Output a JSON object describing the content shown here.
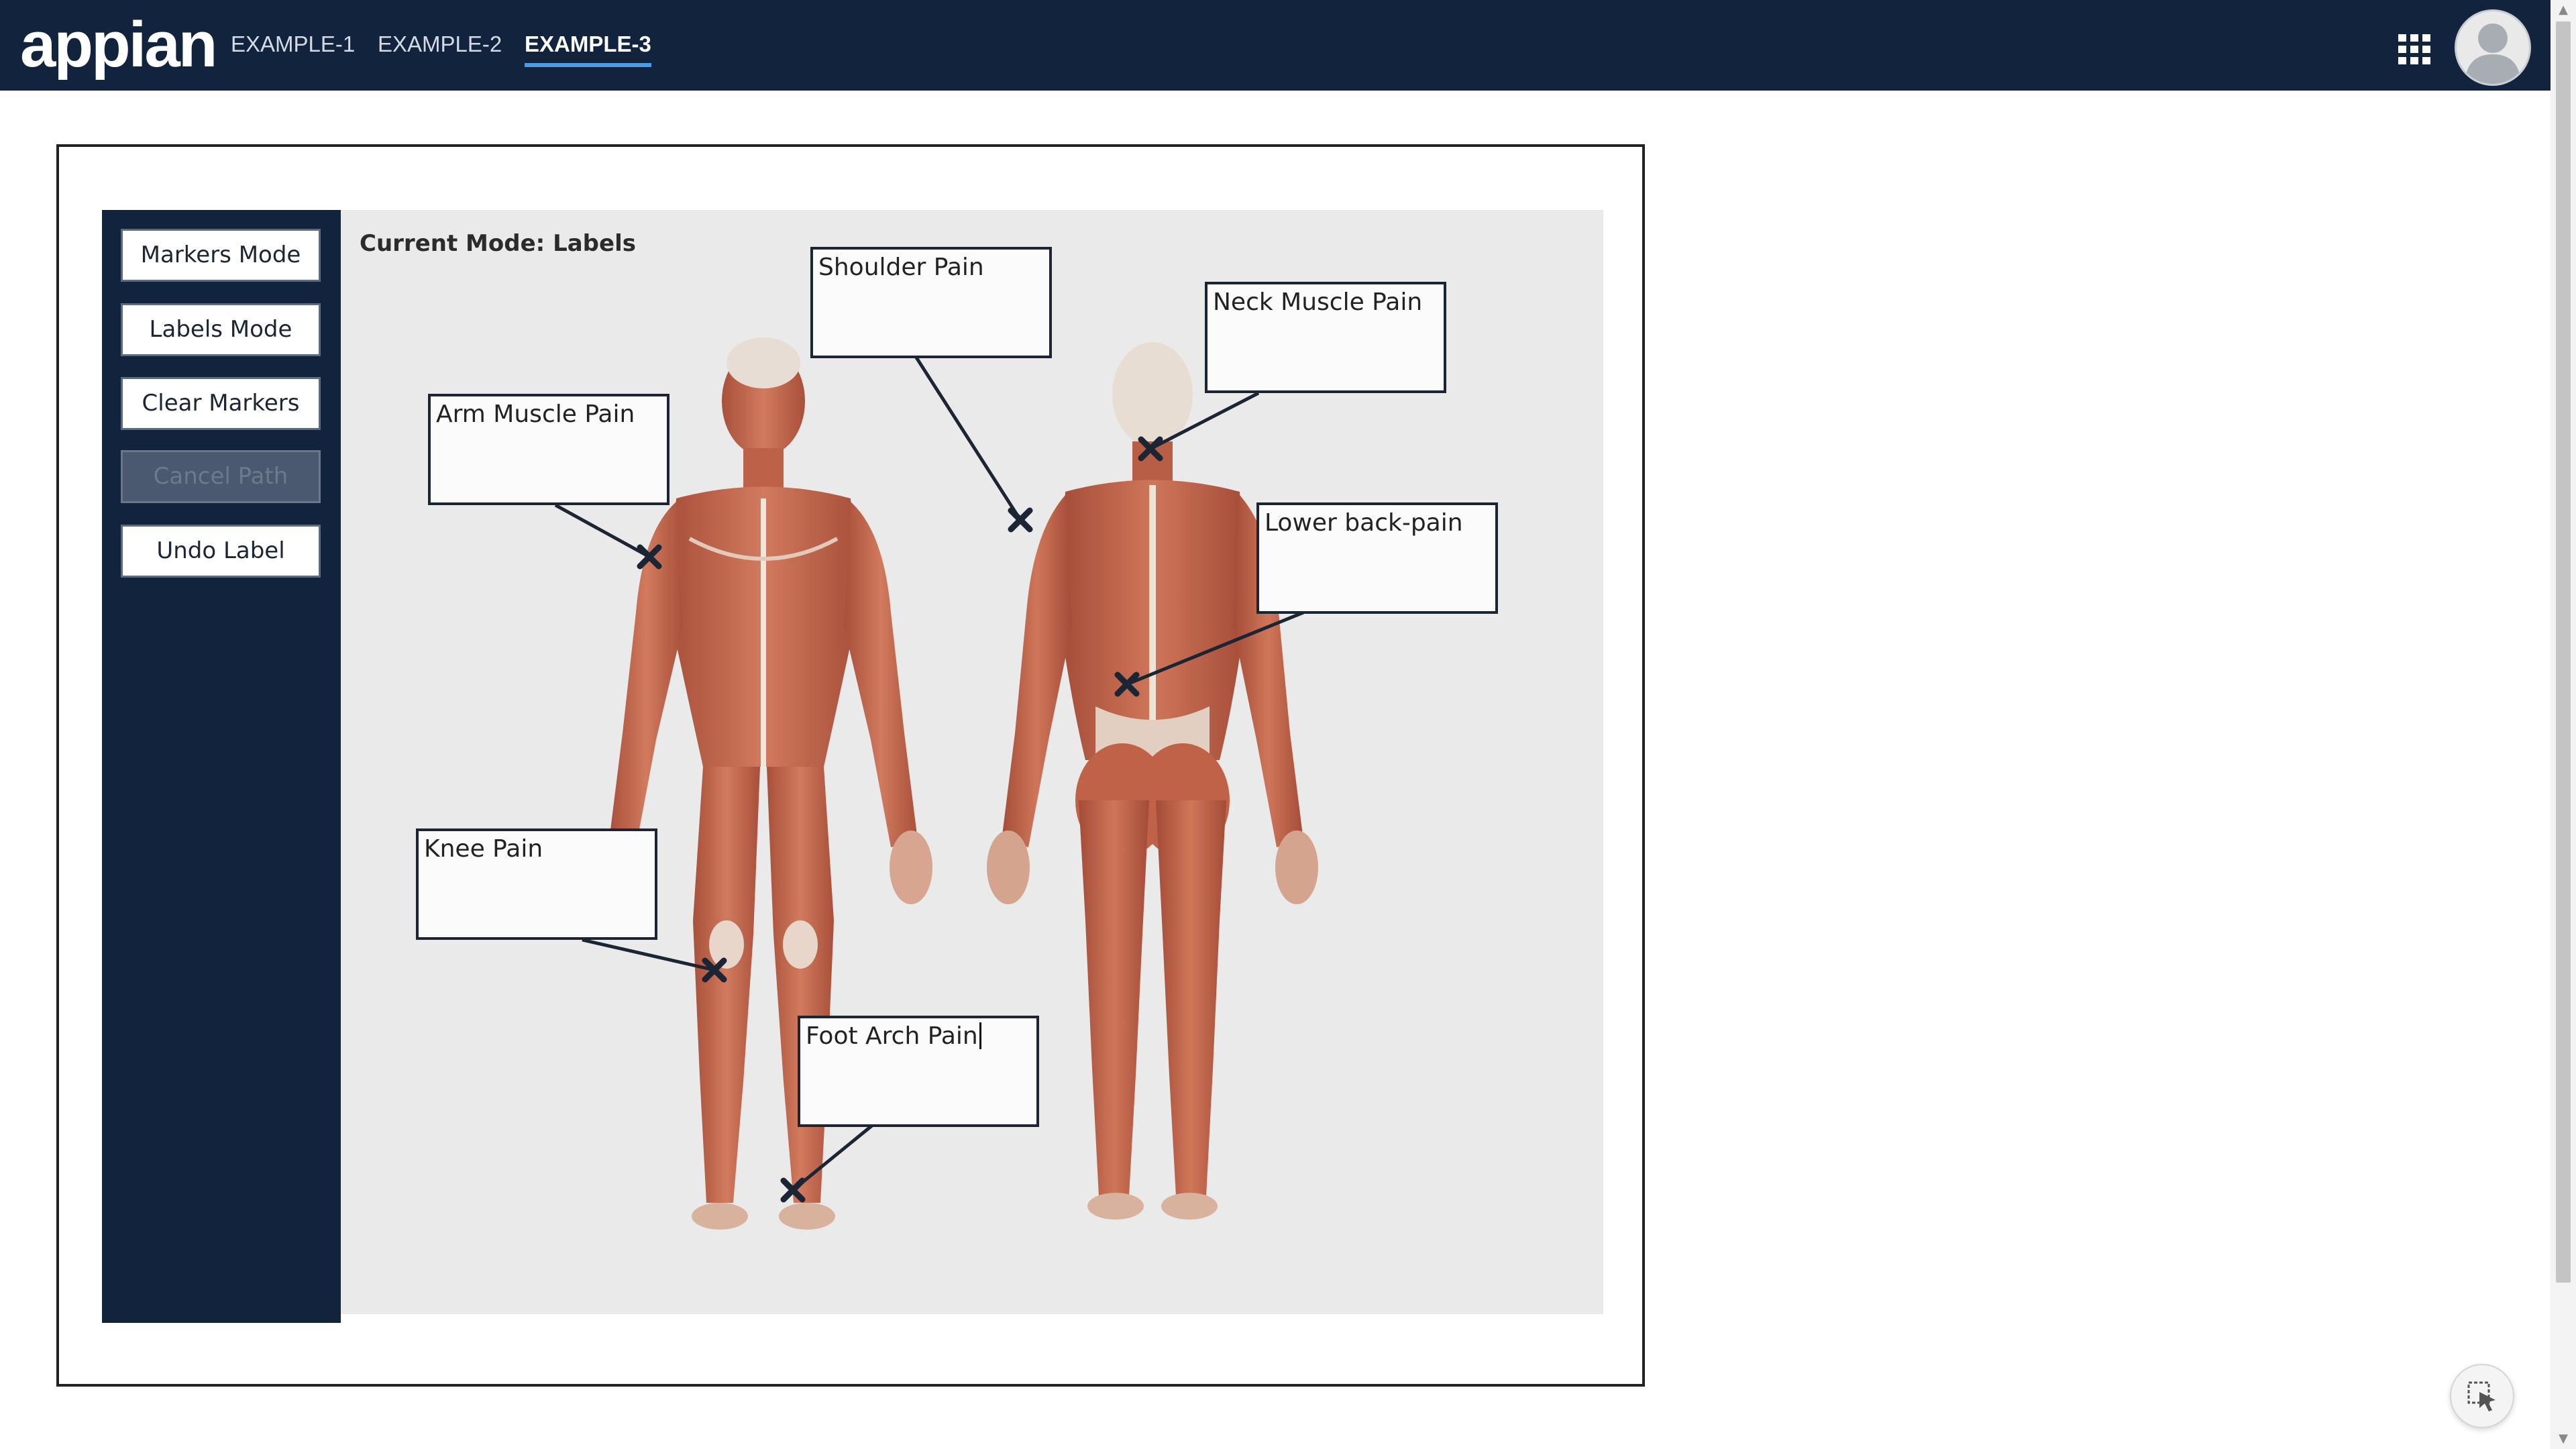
{
  "app": {
    "logo": "appian"
  },
  "nav": {
    "tabs": [
      {
        "label": "EXAMPLE-1",
        "active": false
      },
      {
        "label": "EXAMPLE-2",
        "active": false
      },
      {
        "label": "EXAMPLE-3",
        "active": true
      }
    ]
  },
  "sidebar": {
    "buttons": [
      {
        "label": "Markers Mode",
        "enabled": true
      },
      {
        "label": "Labels Mode",
        "enabled": true
      },
      {
        "label": "Clear Markers",
        "enabled": true
      },
      {
        "label": "Cancel Path",
        "enabled": false
      },
      {
        "label": "Undo Label",
        "enabled": true
      }
    ]
  },
  "canvas": {
    "mode_label": "Current Mode: Labels",
    "labels": [
      {
        "text": "Shoulder Pain"
      },
      {
        "text": "Neck Muscle Pain"
      },
      {
        "text": "Arm Muscle Pain"
      },
      {
        "text": "Lower back-pain"
      },
      {
        "text": "Knee Pain"
      },
      {
        "text": "Foot Arch Pain",
        "editing": true
      }
    ]
  },
  "icons": {
    "apps": "grid-icon",
    "avatar": "user-avatar-icon",
    "marker": "x-marker-icon",
    "pointer": "cursor-select-icon"
  },
  "colors": {
    "topbar": "#12233d",
    "sidebar": "#12233d",
    "accent": "#4a9be8",
    "marker": "#1b2533",
    "muscle": "#c8664c"
  }
}
